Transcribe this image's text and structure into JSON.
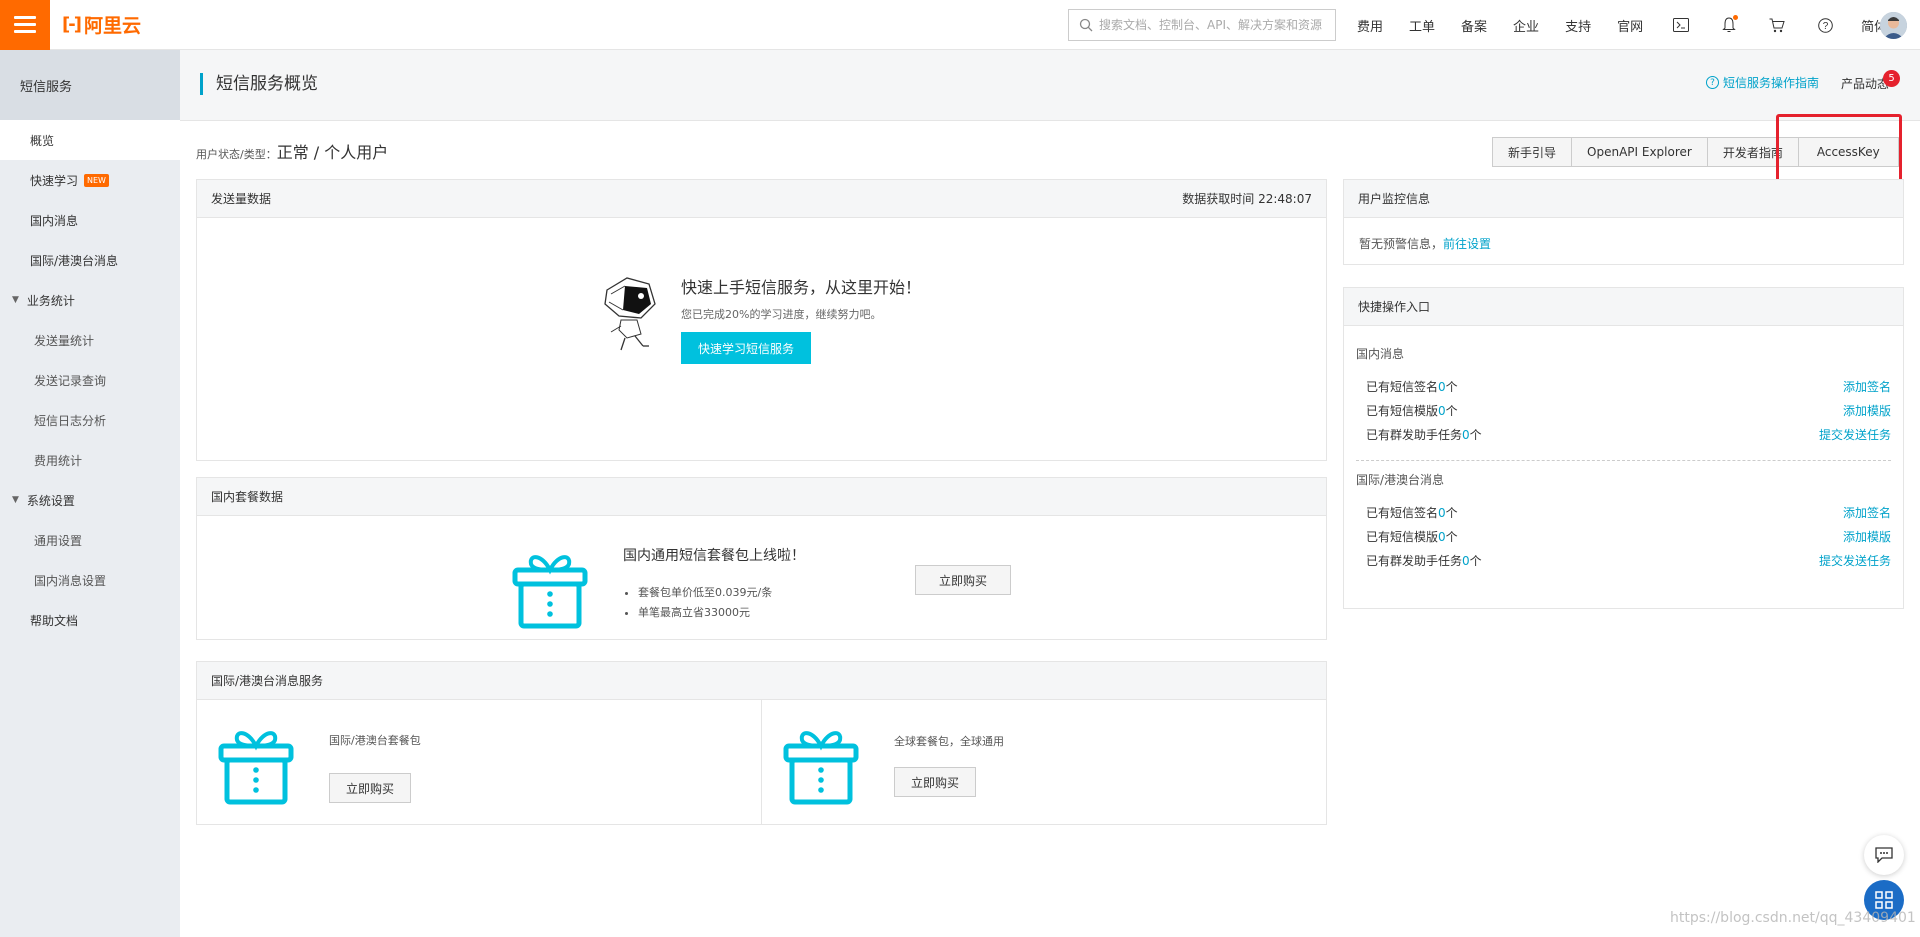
{
  "topbar": {
    "logo_text": "阿里云",
    "search_placeholder": "搜索文档、控制台、API、解决方案和资源",
    "nav": [
      "费用",
      "工单",
      "备案",
      "企业",
      "支持",
      "官网"
    ],
    "lang": "简体"
  },
  "sidebar": {
    "title": "短信服务",
    "items": [
      {
        "label": "概览",
        "type": "item",
        "active": true
      },
      {
        "label": "快速学习",
        "type": "item",
        "badge": "NEW"
      },
      {
        "label": "国内消息",
        "type": "item"
      },
      {
        "label": "国际/港澳台消息",
        "type": "item"
      },
      {
        "label": "业务统计",
        "type": "group"
      },
      {
        "label": "发送量统计",
        "type": "sub"
      },
      {
        "label": "发送记录查询",
        "type": "sub"
      },
      {
        "label": "短信日志分析",
        "type": "sub"
      },
      {
        "label": "费用统计",
        "type": "sub"
      },
      {
        "label": "系统设置",
        "type": "group"
      },
      {
        "label": "通用设置",
        "type": "sub"
      },
      {
        "label": "国内消息设置",
        "type": "sub"
      },
      {
        "label": "帮助文档",
        "type": "item"
      }
    ]
  },
  "header": {
    "title": "短信服务概览",
    "guide_link": "短信服务操作指南",
    "product_news": "产品动态",
    "product_news_count": "5"
  },
  "user_status": {
    "label": "用户状态/类型：",
    "value": "正常 / 个人用户"
  },
  "actions": [
    "新手引导",
    "OpenAPI Explorer",
    "开发者指南",
    "AccessKey"
  ],
  "send_panel": {
    "title": "发送量数据",
    "fetch_time": "数据获取时间 22:48:07",
    "cta_title": "快速上手短信服务，从这里开始！",
    "cta_sub": "您已完成20%的学习进度，继续努力吧。",
    "cta_button": "快速学习短信服务"
  },
  "domestic_pkg": {
    "title": "国内套餐数据",
    "pkg_title": "国内通用短信套餐包上线啦！",
    "bullets": [
      "套餐包单价低至0.039元/条",
      "单笔最高立省33000元"
    ],
    "buy": "立即购买"
  },
  "intl_panel": {
    "title": "国际/港澳台消息服务",
    "left_label": "国际/港澳台套餐包",
    "left_buy": "立即购买",
    "right_label": "全球套餐包，全球通用",
    "right_buy": "立即购买"
  },
  "monitor": {
    "title": "用户监控信息",
    "text": "暂无预警信息，",
    "link": "前往设置"
  },
  "quick": {
    "title": "快捷操作入口",
    "domestic_title": "国内消息",
    "domestic_rows": [
      {
        "pre": "已有短信签名",
        "num": "0",
        "post": "个",
        "action": "添加签名"
      },
      {
        "pre": "已有短信模版",
        "num": "0",
        "post": "个",
        "action": "添加模版"
      },
      {
        "pre": "已有群发助手任务",
        "num": "0",
        "post": "个",
        "action": "提交发送任务"
      }
    ],
    "intl_title": "国际/港澳台消息",
    "intl_rows": [
      {
        "pre": "已有短信签名",
        "num": "0",
        "post": "个",
        "action": "添加签名"
      },
      {
        "pre": "已有短信模版",
        "num": "0",
        "post": "个",
        "action": "添加模版"
      },
      {
        "pre": "已有群发助手任务",
        "num": "0",
        "post": "个",
        "action": "提交发送任务"
      }
    ]
  },
  "watermark": "https://blog.csdn.net/qq_43409401",
  "colors": {
    "brand": "#ff6a00",
    "accent": "#00c1de",
    "link": "#00a2ca",
    "highlight": "#e5212d"
  }
}
